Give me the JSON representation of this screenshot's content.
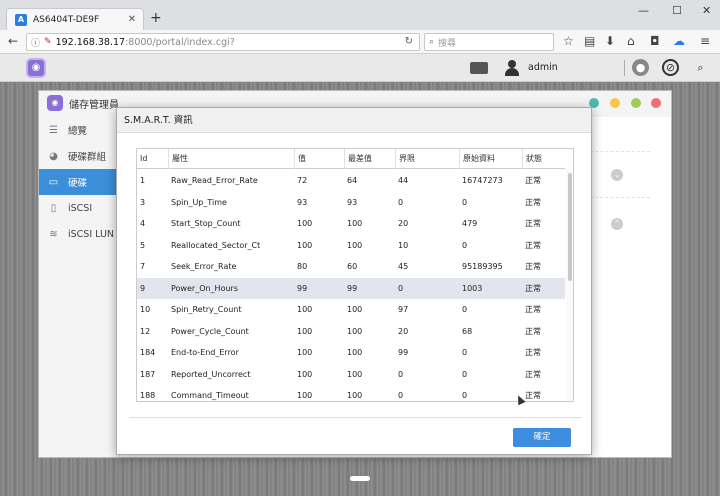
{
  "browser": {
    "tab_title": "AS6404T-DE9F",
    "favicon_letter": "A",
    "new_tab": "+",
    "url_host": "192.168.38.17",
    "url_path": ":8000/portal/index.cgi?",
    "search_placeholder": "搜尋"
  },
  "topbar": {
    "username": "admin"
  },
  "app": {
    "title": "儲存管理員",
    "sidebar": [
      {
        "label": "總覽",
        "icon": "overview-icon"
      },
      {
        "label": "硬碟群組",
        "icon": "volume-icon"
      },
      {
        "label": "硬碟",
        "icon": "disk-icon",
        "active": true
      },
      {
        "label": "iSCSI",
        "icon": "iscsi-icon"
      },
      {
        "label": "iSCSI LUN",
        "icon": "lun-icon"
      }
    ],
    "dot_colors": [
      "#4fb9b4",
      "#f5c84a",
      "#9ccc5a",
      "#ef6e78"
    ]
  },
  "dialog": {
    "title": "S.M.A.R.T. 資訊",
    "columns": [
      "Id",
      "屬性",
      "值",
      "最差值",
      "界限",
      "原始資料",
      "狀態"
    ],
    "rows": [
      [
        "1",
        "Raw_Read_Error_Rate",
        "72",
        "64",
        "44",
        "16747273",
        "正常"
      ],
      [
        "3",
        "Spin_Up_Time",
        "93",
        "93",
        "0",
        "0",
        "正常"
      ],
      [
        "4",
        "Start_Stop_Count",
        "100",
        "100",
        "20",
        "479",
        "正常"
      ],
      [
        "5",
        "Reallocated_Sector_Ct",
        "100",
        "100",
        "10",
        "0",
        "正常"
      ],
      [
        "7",
        "Seek_Error_Rate",
        "80",
        "60",
        "45",
        "95189395",
        "正常"
      ],
      [
        "9",
        "Power_On_Hours",
        "99",
        "99",
        "0",
        "1003",
        "正常"
      ],
      [
        "10",
        "Spin_Retry_Count",
        "100",
        "100",
        "97",
        "0",
        "正常"
      ],
      [
        "12",
        "Power_Cycle_Count",
        "100",
        "100",
        "20",
        "68",
        "正常"
      ],
      [
        "184",
        "End-to-End_Error",
        "100",
        "100",
        "99",
        "0",
        "正常"
      ],
      [
        "187",
        "Reported_Uncorrect",
        "100",
        "100",
        "0",
        "0",
        "正常"
      ],
      [
        "188",
        "Command_Timeout",
        "100",
        "100",
        "0",
        "0",
        "正常"
      ]
    ],
    "highlighted_row": 5,
    "ok_label": "確定"
  }
}
